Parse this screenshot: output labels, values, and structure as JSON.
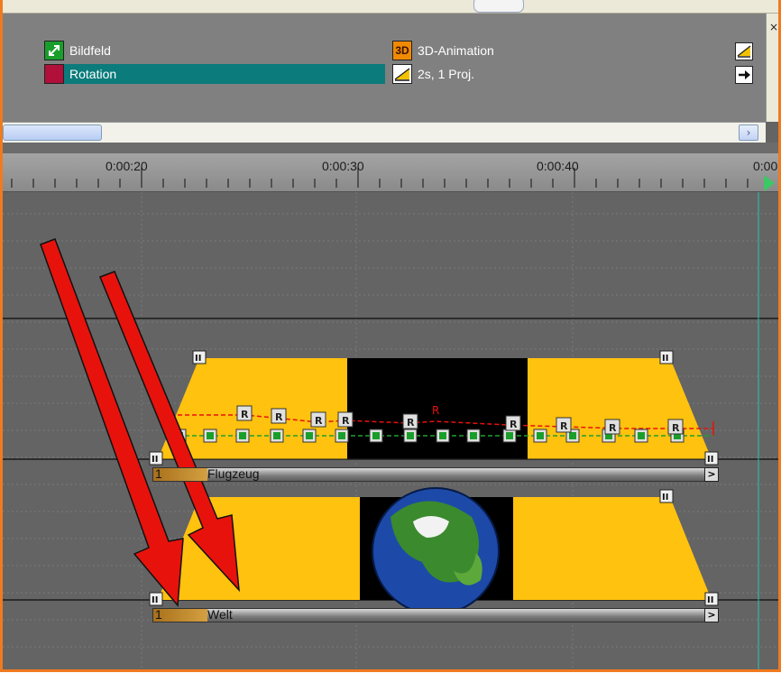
{
  "effects": {
    "left": [
      {
        "label": "Bildfeld",
        "icon": "bildfeld-icon",
        "color": "#1a9e2b"
      },
      {
        "label": "Rotation",
        "icon": "rotation-icon",
        "color": "#b0103a",
        "selected": true
      }
    ],
    "right": [
      {
        "label": "3D-Animation",
        "icon": "3d-animation-icon",
        "icon_text": "3D",
        "color": "#f08a00"
      },
      {
        "label": "2s, 1 Proj.",
        "icon": "ramp-icon"
      }
    ],
    "side_buttons": [
      "ramp-icon",
      "arrow-right-icon"
    ],
    "close": "×",
    "selected_color": "#0b7b7b"
  },
  "scroll": {
    "right_arrow": "›"
  },
  "ruler": {
    "labels": [
      "0:00:20",
      "0:00:30",
      "0:00:40",
      "0:00"
    ]
  },
  "tracks": [
    {
      "name": "Flugzeug",
      "number": "1",
      "end_marker": ">"
    },
    {
      "name": "Welt",
      "number": "1",
      "end_marker": ">"
    }
  ],
  "keyframes": {
    "rotation_label": "R",
    "marker_label": "II",
    "bubble": "R"
  },
  "colors": {
    "clip": "#ffc20e",
    "arrow": "#e8120c",
    "accent": "#f07a1e",
    "playhead": "#3cc864"
  }
}
